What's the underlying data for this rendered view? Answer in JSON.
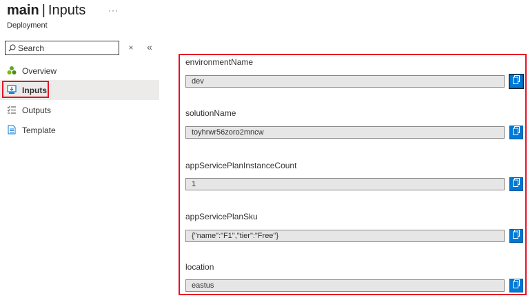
{
  "header": {
    "title": "main",
    "separator": "|",
    "section": "Inputs",
    "more": "···",
    "subtitle": "Deployment"
  },
  "search": {
    "placeholder": "Search",
    "value": ""
  },
  "sidebar": {
    "clear": "×",
    "collapse": "«",
    "items": [
      {
        "label": "Overview",
        "icon": "overview-icon"
      },
      {
        "label": "Inputs",
        "icon": "inputs-icon",
        "active": true
      },
      {
        "label": "Outputs",
        "icon": "outputs-icon"
      },
      {
        "label": "Template",
        "icon": "template-icon"
      }
    ]
  },
  "fields": [
    {
      "label": "environmentName",
      "value": "dev"
    },
    {
      "label": "solutionName",
      "value": "toyhrwr56zoro2mncw"
    },
    {
      "label": "appServicePlanInstanceCount",
      "value": "1"
    },
    {
      "label": "appServicePlanSku",
      "value": "{\"name\":\"F1\",\"tier\":\"Free\"}"
    },
    {
      "label": "location",
      "value": "eastus"
    }
  ],
  "colors": {
    "accent": "#0078d4",
    "highlight": "#e81123",
    "active_bg": "#edebe9"
  }
}
